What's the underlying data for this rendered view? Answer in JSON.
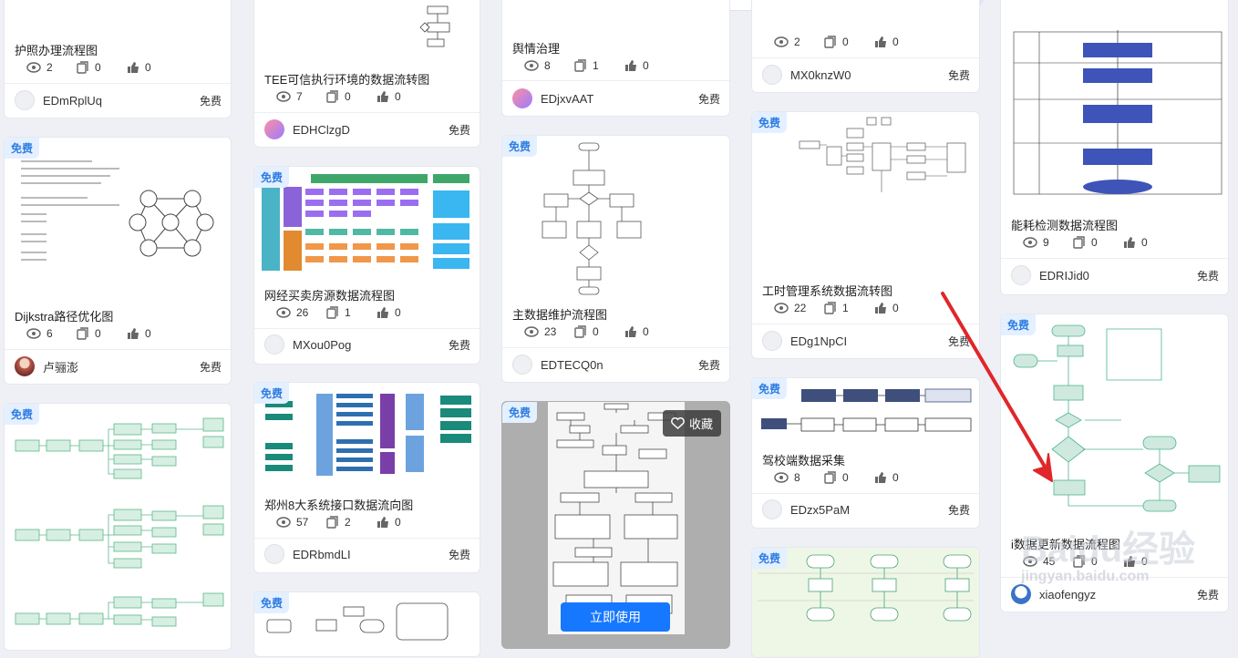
{
  "labels": {
    "free": "免费",
    "fav": "收藏",
    "use": "立即使用"
  },
  "watermark": {
    "brand": "Baidu经验",
    "url": "jingyan.baidu.com"
  },
  "cards": [
    {
      "title": "护照办理流程图",
      "views": "2",
      "copies": "0",
      "likes": "0",
      "author": "EDmRplUq",
      "price": "免费"
    },
    {
      "title": "Dijkstra路径优化图",
      "views": "6",
      "copies": "0",
      "likes": "0",
      "author": "卢骊澎",
      "price": "免费"
    },
    {
      "title": "TEE可信执行环境的数据流转图",
      "views": "7",
      "copies": "0",
      "likes": "0",
      "author": "EDHClzgD",
      "price": "免费"
    },
    {
      "title": "网经买卖房源数据流程图",
      "views": "26",
      "copies": "1",
      "likes": "0",
      "author": "MXou0Pog",
      "price": "免费"
    },
    {
      "title": "郑州8大系统接口数据流向图",
      "views": "57",
      "copies": "2",
      "likes": "0",
      "author": "EDRbmdLI",
      "price": "免费"
    },
    {
      "title": "舆情治理",
      "views": "8",
      "copies": "1",
      "likes": "0",
      "author": "EDjxvAAT",
      "price": "免费"
    },
    {
      "title": "主数据维护流程图",
      "views": "23",
      "copies": "0",
      "likes": "0",
      "author": "EDTECQ0n",
      "price": "免费"
    },
    {
      "title": "",
      "views": "2",
      "copies": "0",
      "likes": "0",
      "author": "MX0knzW0",
      "price": "免费"
    },
    {
      "title": "工时管理系统数据流转图",
      "views": "22",
      "copies": "1",
      "likes": "0",
      "author": "EDg1NpCI",
      "price": "免费"
    },
    {
      "title": "驾校端数据采集",
      "views": "8",
      "copies": "0",
      "likes": "0",
      "author": "EDzx5PaM",
      "price": "免费"
    },
    {
      "title": "能耗检测数据流程图",
      "views": "9",
      "copies": "0",
      "likes": "0",
      "author": "EDRIJid0",
      "price": "免费"
    },
    {
      "title": "i数据更新数据流程图",
      "views": "45",
      "copies": "0",
      "likes": "0",
      "author": "xiaofengyz",
      "price": "免费"
    }
  ],
  "colors": {
    "accent": "#1677ff",
    "badge_text": "#2f7de1",
    "arrow": "#e0262a"
  }
}
